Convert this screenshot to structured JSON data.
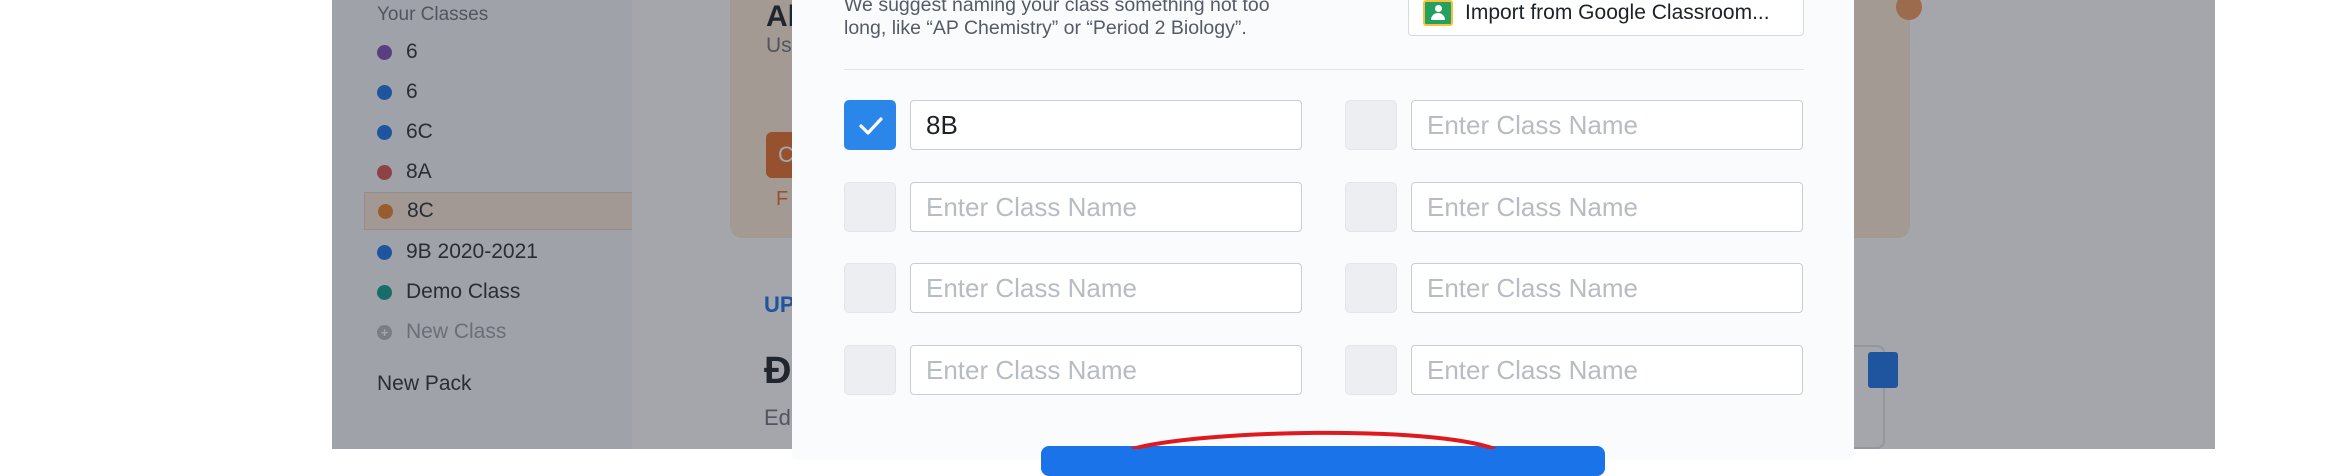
{
  "sidebar": {
    "heading": "Your Classes",
    "classes": [
      {
        "label": "6",
        "color": "#7d4fb8"
      },
      {
        "label": "6",
        "color": "#1a73e8"
      },
      {
        "label": "6C",
        "color": "#1a73e8"
      },
      {
        "label": "8A",
        "color": "#d9534f"
      },
      {
        "label": "8C",
        "color": "#e8822a"
      },
      {
        "label": "9B 2020-2021",
        "color": "#1a73e8"
      },
      {
        "label": "Demo Class",
        "color": "#0f9e8e"
      }
    ],
    "new_class": "New Class",
    "new_pack": "New Pack"
  },
  "background": {
    "hero_title": "Al",
    "hero_sub": "Us",
    "hero_button_initial": "C",
    "hero_link_initial": "F",
    "section_label": "UP",
    "section_title": "Đ",
    "section_sub": "Ed"
  },
  "modal": {
    "suggestion": "We suggest naming your class something not too long, like “AP Chemistry” or “Period 2 Biology”.",
    "import_label": "Import from Google Classroom...",
    "placeholder": "Enter Class Name",
    "rows": [
      {
        "left": {
          "checked": true,
          "value": "8B"
        },
        "right": {
          "checked": false,
          "value": ""
        }
      },
      {
        "left": {
          "checked": false,
          "value": ""
        },
        "right": {
          "checked": false,
          "value": ""
        }
      },
      {
        "left": {
          "checked": false,
          "value": ""
        },
        "right": {
          "checked": false,
          "value": ""
        }
      },
      {
        "left": {
          "checked": false,
          "value": ""
        },
        "right": {
          "checked": false,
          "value": ""
        }
      }
    ]
  },
  "colors": {
    "accent": "#1a73e8",
    "checkbox_checked": "#2b86ea",
    "annotation": "#e0191f",
    "hero_orange": "#e76f29"
  }
}
